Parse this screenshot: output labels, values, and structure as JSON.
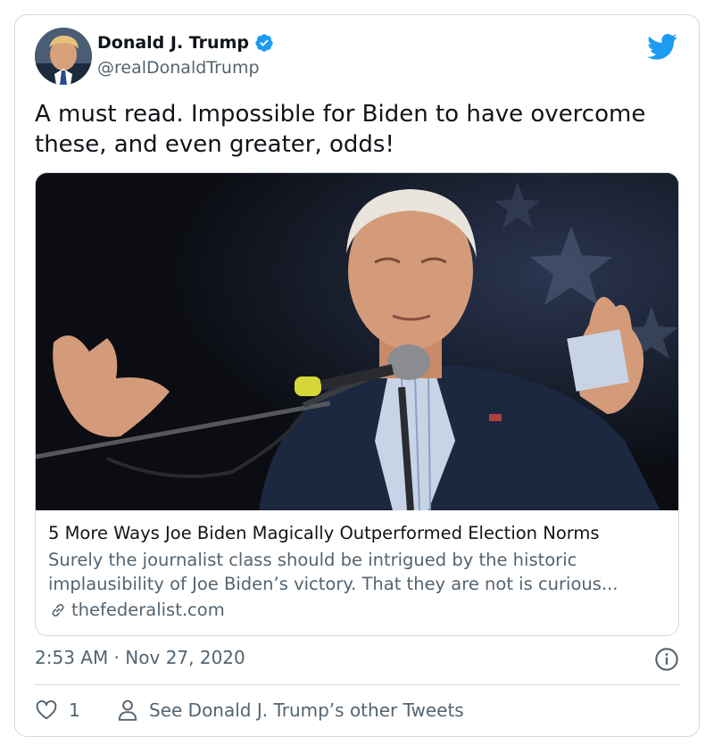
{
  "author": {
    "name": "Donald J. Trump",
    "handle": "@realDonaldTrump",
    "verified": true,
    "avatar_icon": "avatar-photo"
  },
  "brand": {
    "icon": "twitter-bird-icon",
    "color": "#1d9bf0"
  },
  "tweet": {
    "text": "A must read. Impossible for Biden to have overcome these, and even greater, odds!"
  },
  "link_card": {
    "image_icon": "article-photo",
    "title": "5 More Ways Joe Biden Magically Outperformed Election Norms",
    "description": "Surely the journalist class should be intrigued by the historic implausibility of Joe Biden’s victory. That they are not is curious...",
    "domain": "thefederalist.com"
  },
  "meta": {
    "time": "2:53 AM",
    "separator": "·",
    "date": "Nov 27, 2020"
  },
  "actions": {
    "like_count": "1",
    "other_tweets_label": "See Donald J. Trump’s other Tweets"
  },
  "colors": {
    "text_primary": "#0f1419",
    "text_secondary": "#536471",
    "border": "#cfd9de",
    "verified_blue": "#1d9bf0"
  }
}
